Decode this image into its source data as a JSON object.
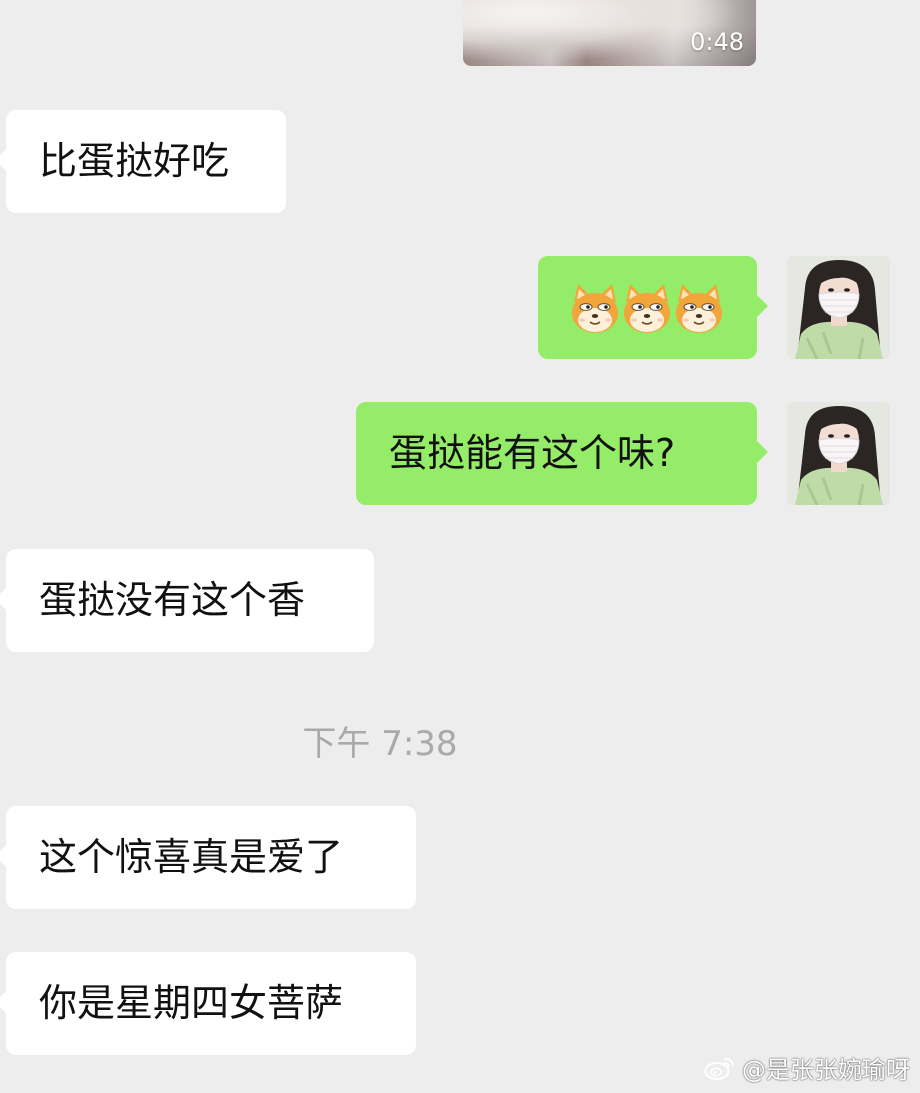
{
  "video": {
    "duration": "0:48"
  },
  "messages": [
    {
      "side": "received",
      "text": "比蛋挞好吃"
    },
    {
      "side": "sent",
      "type": "emoji",
      "emoji": [
        "doge-icon",
        "doge-icon",
        "doge-icon"
      ]
    },
    {
      "side": "sent",
      "text": "蛋挞能有这个味?"
    },
    {
      "side": "received",
      "text": "蛋挞没有这个香"
    },
    {
      "side": "received",
      "text": "这个惊喜真是爱了"
    },
    {
      "side": "received",
      "text": "你是星期四女菩萨"
    }
  ],
  "timestamp": "下午 7:38",
  "watermark": "@是张张婉瑜呀",
  "colors": {
    "background": "#ededed",
    "received_bubble": "#ffffff",
    "sent_bubble": "#95ec69",
    "timestamp": "#a9a9a9"
  }
}
